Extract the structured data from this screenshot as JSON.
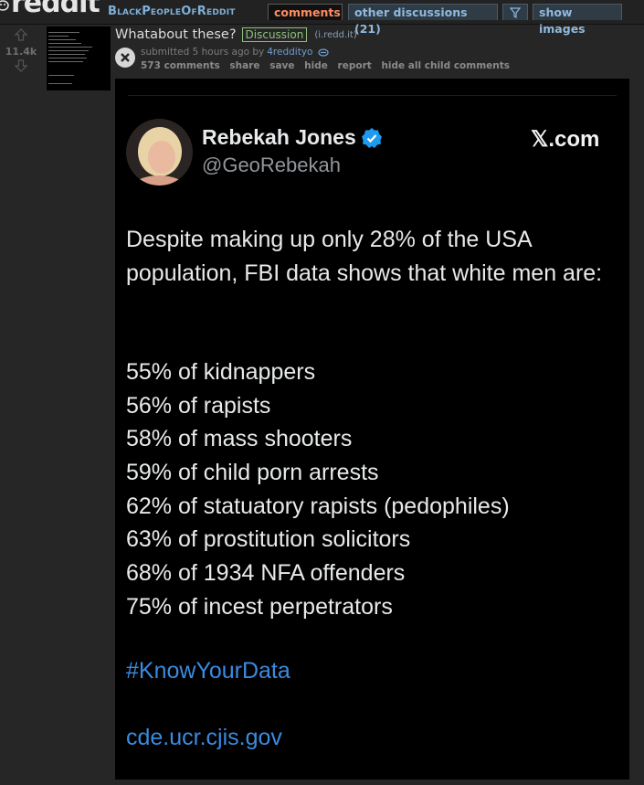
{
  "header": {
    "logo_text": "reddit",
    "subreddit": "BlackPeopleOfReddit",
    "tabs": {
      "comments": "comments",
      "other_discussions": "other discussions (21)",
      "show_images": "show images"
    }
  },
  "post": {
    "score": "11.4k",
    "title": "Whatabout these?",
    "flair": "Discussion",
    "domain": "(i.redd.it)",
    "submitted_prefix": "submitted 5 hours ago by",
    "author": "4reddityo",
    "buttons": [
      "573 comments",
      "share",
      "save",
      "hide",
      "report",
      "hide all child comments"
    ]
  },
  "tweet": {
    "name": "Rebekah Jones",
    "handle": "@GeoRebekah",
    "source": "𝕏.com",
    "body": "Despite making up only 28% of the USA population, FBI data shows that white men are:",
    "stats": [
      "55% of kidnappers",
      "56% of rapists",
      "58% of mass shooters",
      "59% of child porn arrests",
      "62% of statuatory rapists (pedophiles)",
      "63% of prostitution solicitors",
      "68% of 1934 NFA offenders",
      "75% of incest perpetrators"
    ],
    "hashtag": "#KnowYourData",
    "link": "cde.ucr.cjis.gov"
  },
  "colors": {
    "background": "#262626",
    "link_blue": "#3a8be0",
    "verified_blue": "#1d9bf0",
    "comments_tab": "#ff8b60",
    "flair_green": "#8ec07c"
  },
  "icons": [
    "alien-icon",
    "upvote-icon",
    "downvote-icon",
    "filter-icon",
    "moderator-icon",
    "verified-badge-icon"
  ]
}
